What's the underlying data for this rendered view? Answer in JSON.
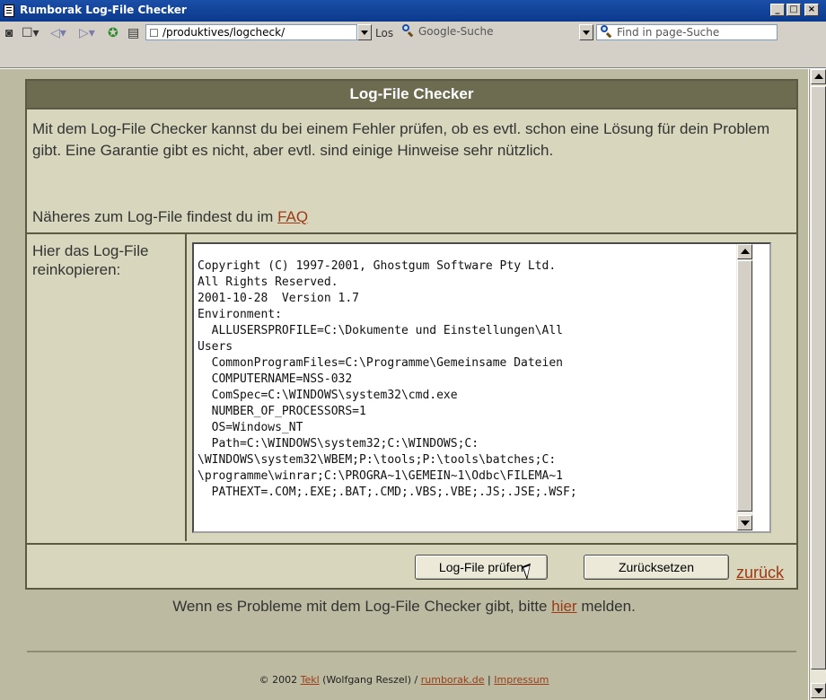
{
  "window": {
    "title": "Rumborak Log-File Checker",
    "minimize": "_",
    "maximize": "□",
    "close": "×"
  },
  "toolbar": {
    "address": "/produktives/logcheck/",
    "go_label": "Los",
    "search_placeholder": "Google-Suche",
    "find_placeholder": "Find in page-Suche"
  },
  "main": {
    "header": "Log-File Checker",
    "intro": "Mit dem Log-File Checker kannst du bei einem Fehler prüfen, ob es evtl. schon eine Lösung für dein Problem gibt. Eine Garantie gibt es nicht, aber evtl. sind einige Hinweise sehr nützlich.",
    "faq_prefix": "Näheres zum Log-File findest du im ",
    "faq_link": "FAQ",
    "paste_label": "Hier das Log-File reinkopieren:",
    "log_text": "Copyright (C) 1997-2001, Ghostgum Software Pty Ltd.\nAll Rights Reserved.\n2001-10-28  Version 1.7\nEnvironment:\n  ALLUSERSPROFILE=C:\\Dokumente und Einstellungen\\All\nUsers\n  CommonProgramFiles=C:\\Programme\\Gemeinsame Dateien\n  COMPUTERNAME=NSS-032\n  ComSpec=C:\\WINDOWS\\system32\\cmd.exe\n  NUMBER_OF_PROCESSORS=1\n  OS=Windows_NT\n  Path=C:\\WINDOWS\\system32;C:\\WINDOWS;C:\n\\WINDOWS\\system32\\WBEM;P:\\tools;P:\\tools\\batches;C:\n\\programme\\winrar;C:\\PROGRA~1\\GEMEIN~1\\Odbc\\FILEMA~1\n  PATHEXT=.COM;.EXE;.BAT;.CMD;.VBS;.VBE;.JS;.JSE;.WSF;",
    "check_button": "Log-File prüfen",
    "reset_button": "Zurücksetzen",
    "back_link": "zurück"
  },
  "problem": {
    "prefix": "Wenn es Probleme mit dem Log-File Checker gibt, bitte ",
    "link": "hier",
    "suffix": " melden."
  },
  "footer": {
    "copyright": "© 2002 ",
    "author_link": "Tekl",
    "author_rest": " (Wolfgang Reszel) / ",
    "site_link": "rumborak.de",
    "sep": " | ",
    "impressum_link": "Impressum"
  },
  "colors": {
    "header_bg": "#6d6b50",
    "panel_bg": "#d8d6bc",
    "page_bg": "#bcbaa0",
    "link": "#9b3a16"
  }
}
